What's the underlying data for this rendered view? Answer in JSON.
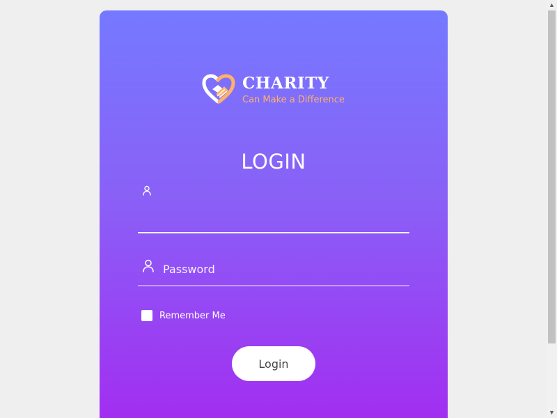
{
  "brand": {
    "title": "CHARITY",
    "tagline": "Can Make a Difference",
    "logo_icon": "heart-handshake-icon",
    "colors": {
      "heart_orange": "#ffb16a",
      "heart_white": "#ffffff"
    }
  },
  "login": {
    "title": "LOGIN",
    "username": {
      "value": "",
      "placeholder": "",
      "icon": "user-icon"
    },
    "password": {
      "value": "",
      "placeholder": "Password",
      "icon": "user-icon"
    },
    "remember_label": "Remember Me",
    "button_label": "Login"
  },
  "theme": {
    "gradient_top": "#7579ff",
    "gradient_bottom": "#a32cf0",
    "page_background": "#efefef"
  },
  "scrollbar": {
    "up_glyph": "▲",
    "down_glyph": "▼"
  }
}
